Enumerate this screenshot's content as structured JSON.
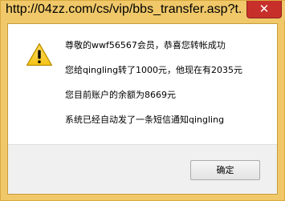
{
  "window": {
    "title": "http://04zz.com/cs/vip/bbs_transfer.asp?t...",
    "close_icon": "close-icon",
    "close_glyph": "✕",
    "frame_color": "#f0c869",
    "close_color": "#c7302a"
  },
  "dialog": {
    "icon": "warning-icon",
    "messages": [
      "尊敬的wwf56567会员，恭喜您转帐成功",
      "您给qingling转了1000元，他现在有2035元",
      "您目前账户的余额为8669元",
      "系统已经自动发了一条短信通知qingling"
    ],
    "ok_label": "确定"
  }
}
